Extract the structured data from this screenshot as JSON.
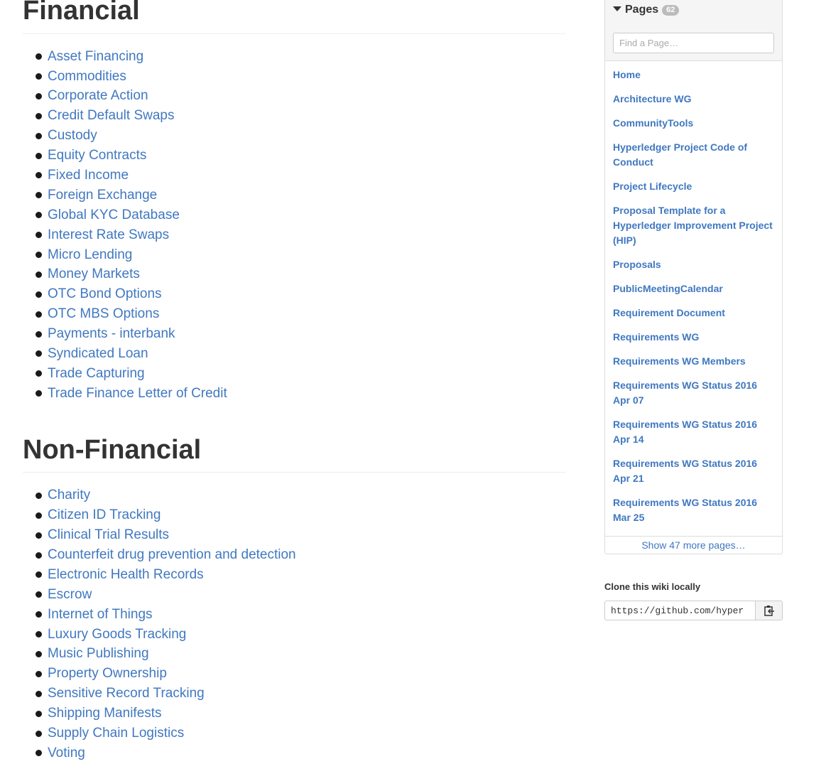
{
  "main": {
    "sections": [
      {
        "heading": "Financial",
        "items": [
          "Asset Financing",
          "Commodities",
          "Corporate Action",
          "Credit Default Swaps",
          "Custody",
          "Equity Contracts",
          "Fixed Income",
          "Foreign Exchange",
          "Global KYC Database",
          "Interest Rate Swaps",
          "Micro Lending",
          "Money Markets",
          "OTC Bond Options",
          "OTC MBS Options",
          "Payments - interbank",
          "Syndicated Loan",
          "Trade Capturing",
          "Trade Finance Letter of Credit"
        ]
      },
      {
        "heading": "Non-Financial",
        "items": [
          "Charity",
          "Citizen ID Tracking",
          "Clinical Trial Results",
          "Counterfeit drug prevention and detection",
          "Electronic Health Records",
          "Escrow",
          "Internet of Things",
          "Luxury Goods Tracking",
          "Music Publishing",
          "Property Ownership",
          "Sensitive Record Tracking",
          "Shipping Manifests",
          "Supply Chain Logistics",
          "Voting"
        ]
      }
    ]
  },
  "sidebar": {
    "pages_title": "Pages",
    "pages_count": "62",
    "find_placeholder": "Find a Page…",
    "pages": [
      "Home",
      "Architecture WG",
      "CommunityTools",
      "Hyperledger Project Code of Conduct",
      "Project Lifecycle",
      "Proposal Template for a Hyperledger Improvement Project (HIP)",
      "Proposals",
      "PublicMeetingCalendar",
      "Requirement Document",
      "Requirements WG",
      "Requirements WG Members",
      "Requirements WG Status 2016 Apr 07",
      "Requirements WG Status 2016 Apr 14",
      "Requirements WG Status 2016 Apr 21",
      "Requirements WG Status 2016 Mar 25"
    ],
    "show_more": "Show 47 more pages…",
    "clone_title": "Clone this wiki locally",
    "clone_url": "https://github.com/hyper",
    "clone_icon": "clipboard-icon"
  },
  "colors": {
    "link": "#4078c0",
    "text": "#333333",
    "border": "#dddddd",
    "header_bg": "#f5f5f5",
    "counter_bg": "#bbbbbb"
  }
}
